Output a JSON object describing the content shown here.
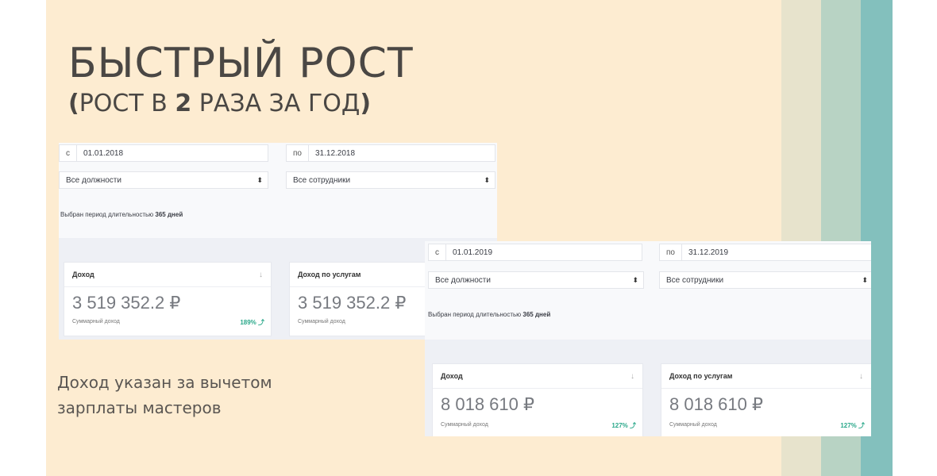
{
  "slide": {
    "title": "БЫСТРЫЙ РОСТ",
    "subtitle_open": "(",
    "subtitle_text": "РОСТ В ",
    "subtitle_num": "2",
    "subtitle_rest": " РАЗА ЗА ГОД",
    "subtitle_close": ")",
    "note_line1": "Доход указан за вычетом",
    "note_line2": "зарплаты мастеров"
  },
  "report2018": {
    "from_prefix": "с",
    "from_value": "01.01.2018",
    "to_prefix": "по",
    "to_value": "31.12.2018",
    "positions": "Все должности",
    "employees": "Все сотрудники",
    "period_text": "Выбран период длительностью",
    "period_days": "365 дней",
    "income": {
      "label": "Доход",
      "sort_icon": "↓",
      "amount": "3 519 352.2 ₽",
      "caption": "Суммарный доход",
      "growth": "189% ⤴"
    },
    "services": {
      "label": "Доход по услугам",
      "amount": "3 519 352.2 ₽",
      "caption": "Суммарный доход"
    }
  },
  "report2019": {
    "from_prefix": "с",
    "from_value": "01.01.2019",
    "to_prefix": "по",
    "to_value": "31.12.2019",
    "positions": "Все должности",
    "employees": "Все сотрудники",
    "period_text": "Выбран период длительностью",
    "period_days": "365 дней",
    "income": {
      "label": "Доход",
      "sort_icon": "↓",
      "amount": "8 018 610 ₽",
      "caption": "Суммарный доход",
      "growth": "127% ⤴"
    },
    "services": {
      "label": "Доход по услугам",
      "sort_icon": "↓",
      "amount": "8 018 610 ₽",
      "caption": "Суммарный доход",
      "growth": "127% ⤴"
    }
  },
  "colors": {
    "slide_bg": "#fdecd1",
    "stripe1": "#e7e3cc",
    "stripe2": "#b8d3c4",
    "stripe3": "#83c0bd",
    "growth": "#2aa88a"
  }
}
